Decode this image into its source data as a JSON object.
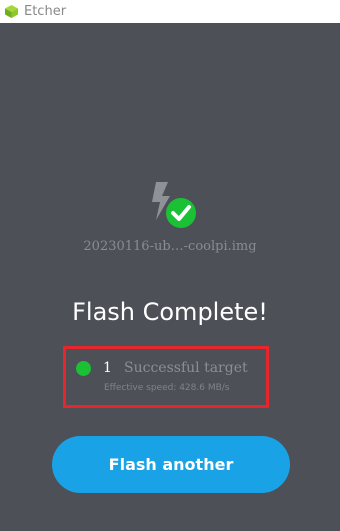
{
  "window": {
    "title": "Etcher",
    "app_icon": "etcher-cube-icon"
  },
  "main": {
    "drive_icon": "flash-bolt-check-icon",
    "image_name": "20230116-ub…-coolpi.img",
    "headline": "Flash Complete!",
    "result": {
      "count": "1",
      "label": "Successful target",
      "speed": "Effective speed: 428.6 MB/s",
      "status_color": "#1ac135",
      "highlight_color": "#e8252a"
    },
    "action_button": "Flash another"
  },
  "colors": {
    "background": "#4d5057",
    "accent": "#19a3e6"
  }
}
